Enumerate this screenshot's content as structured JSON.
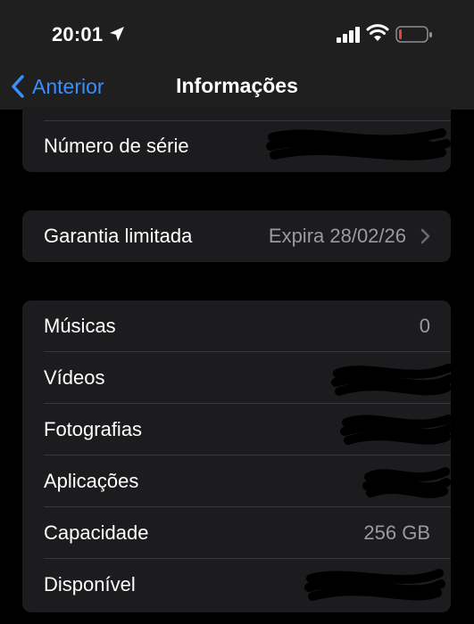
{
  "status_bar": {
    "time": "20:01",
    "icons": [
      "location-arrow-icon",
      "cellular-signal-icon",
      "wifi-icon",
      "battery-low-icon"
    ],
    "battery_color": "#e0463b"
  },
  "nav": {
    "back_label": "Anterior",
    "title": "Informações",
    "accent": "#3a8dff"
  },
  "group1": {
    "serial": {
      "label": "Número de série",
      "value": ""
    }
  },
  "group2": {
    "warranty": {
      "label": "Garantia limitada",
      "value": "Expira 28/02/26"
    }
  },
  "group3": {
    "rows": [
      {
        "label": "Músicas",
        "value": "0"
      },
      {
        "label": "Vídeos",
        "value": ""
      },
      {
        "label": "Fotografias",
        "value": ""
      },
      {
        "label": "Aplicações",
        "value": ""
      },
      {
        "label": "Capacidade",
        "value": "256 GB"
      },
      {
        "label": "Disponível",
        "value": ""
      }
    ]
  }
}
